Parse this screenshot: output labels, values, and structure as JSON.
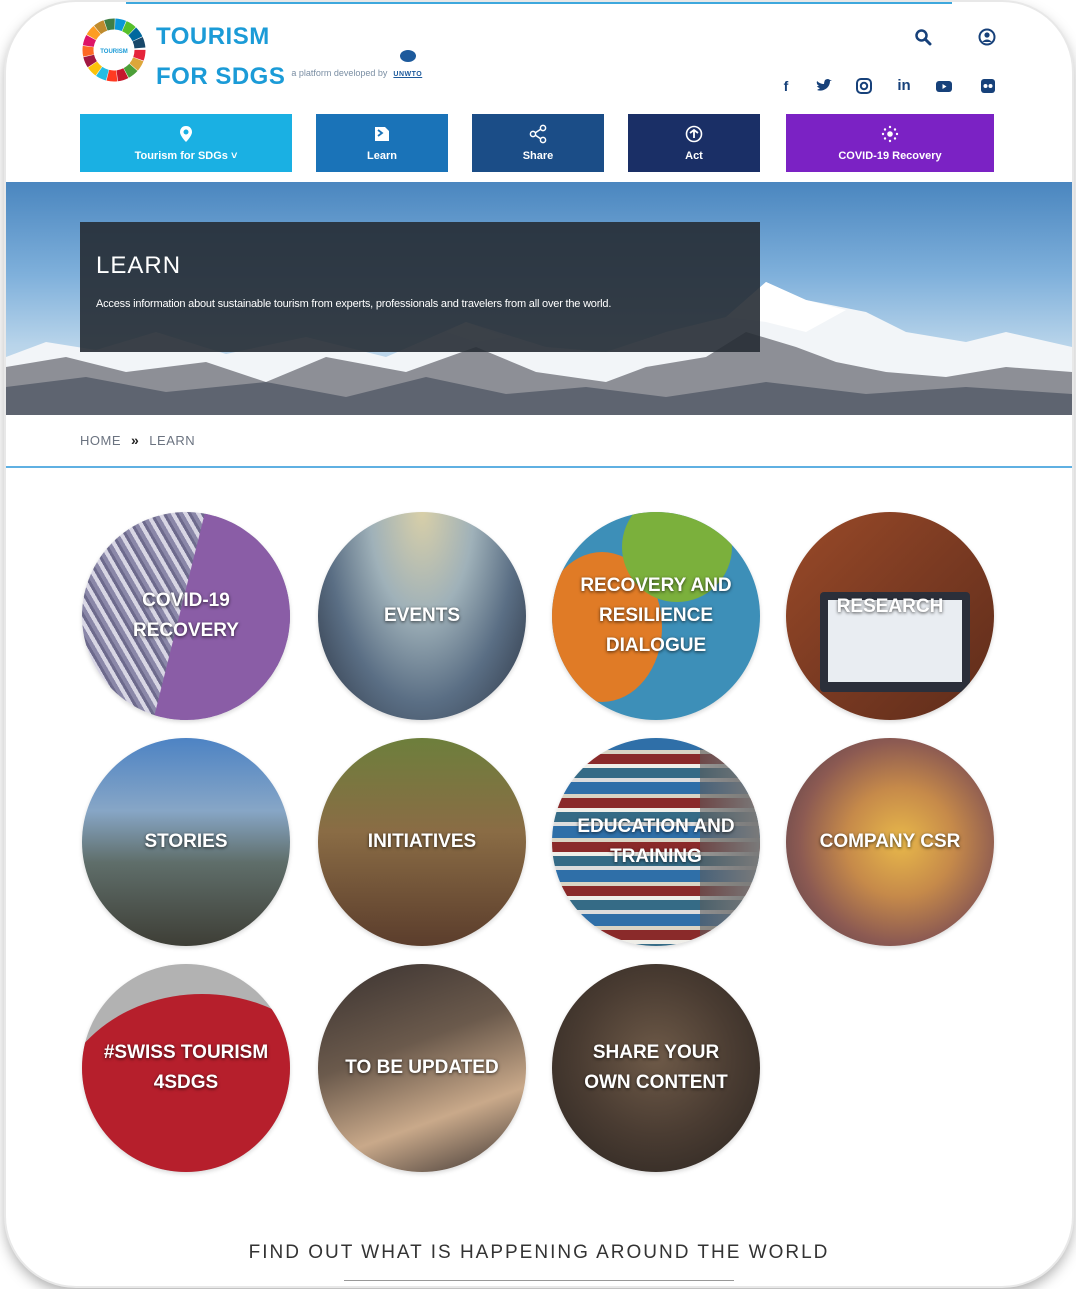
{
  "header": {
    "brand_line1": "TOURISM",
    "brand_line2": "FOR SDGS",
    "tagline": "a platform developed by",
    "partner": "UNWTO",
    "logo_inner": "TOURISM",
    "search_icon": "search-icon",
    "user_icon": "user-icon",
    "social": [
      "facebook-icon",
      "twitter-icon",
      "instagram-icon",
      "linkedin-icon",
      "youtube-icon",
      "flickr-icon"
    ]
  },
  "nav": [
    {
      "label": "Tourism for SDGs ˅",
      "icon": "location-pin-icon",
      "color": "#1ab0e3"
    },
    {
      "label": "Learn",
      "icon": "book-icon",
      "color": "#1a73b8"
    },
    {
      "label": "Share",
      "icon": "share-icon",
      "color": "#1b4d87"
    },
    {
      "label": "Act",
      "icon": "act-icon",
      "color": "#1a2f66"
    },
    {
      "label": "COVID-19 Recovery",
      "icon": "covid-icon",
      "color": "#7b22c4"
    }
  ],
  "hero": {
    "title": "LEARN",
    "subtitle": "Access information about sustainable tourism from experts, professionals and travelers from all over the world."
  },
  "breadcrumb": {
    "home": "HOME",
    "separator": "»",
    "current": "LEARN"
  },
  "tiles": [
    {
      "label": "COVID-19 RECOVERY"
    },
    {
      "label": "EVENTS"
    },
    {
      "label": "RECOVERY AND RESILIENCE DIALOGUE"
    },
    {
      "label": "RESEARCH"
    },
    {
      "label": "STORIES"
    },
    {
      "label": "INITIATIVES"
    },
    {
      "label": "EDUCATION AND TRAINING"
    },
    {
      "label": "COMPANY CSR"
    },
    {
      "label": "#SWISS TOURISM 4SDGS"
    },
    {
      "label": "TO BE UPDATED"
    },
    {
      "label": "SHARE YOUR OWN CONTENT"
    }
  ],
  "footer": {
    "title": "FIND OUT WHAT IS HAPPENING AROUND THE WORLD"
  }
}
